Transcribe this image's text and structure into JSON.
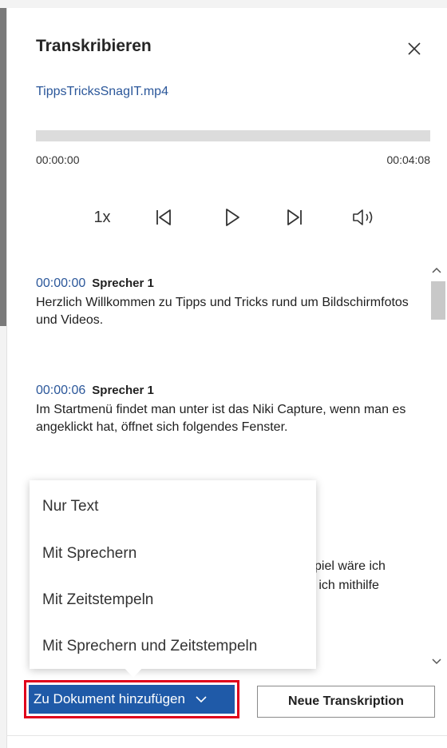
{
  "pane": {
    "title": "Transkribieren",
    "file_name": "TippsTricksSnagIT.mp4"
  },
  "player": {
    "progress": 0,
    "time_current": "00:00:00",
    "time_total": "00:04:08",
    "speed_label": "1x"
  },
  "transcript": [
    {
      "time": "00:00:00",
      "speaker": "Sprecher 1",
      "text": "Herzlich Willkommen zu Tipps und Tricks rund um Bildschirmfotos und Videos."
    },
    {
      "time": "00:00:06",
      "speaker": "Sprecher 1",
      "text": "Im Startmenü findet man unter ist das Niki Capture, wenn man es angeklickt hat, öffnet sich folgendes Fenster."
    },
    {
      "fragment_1": "spiel wäre ich",
      "fragment_2": "n ich mithilfe"
    }
  ],
  "dropdown": {
    "items": [
      "Nur Text",
      "Mit Sprechern",
      "Mit Zeitstempeln",
      "Mit Sprechern und Zeitstempeln"
    ]
  },
  "footer": {
    "add_label": "Zu Dokument hinzufügen",
    "new_label": "Neue Transkription"
  },
  "icons": {
    "close": "close-icon",
    "prev": "skip-back-icon",
    "play": "play-icon",
    "next": "skip-forward-icon",
    "volume": "volume-icon",
    "chevron": "chevron-down-icon"
  },
  "colors": {
    "link": "#2b579a",
    "primary_button": "#1f5aa8",
    "highlight_border": "#e0001b"
  }
}
